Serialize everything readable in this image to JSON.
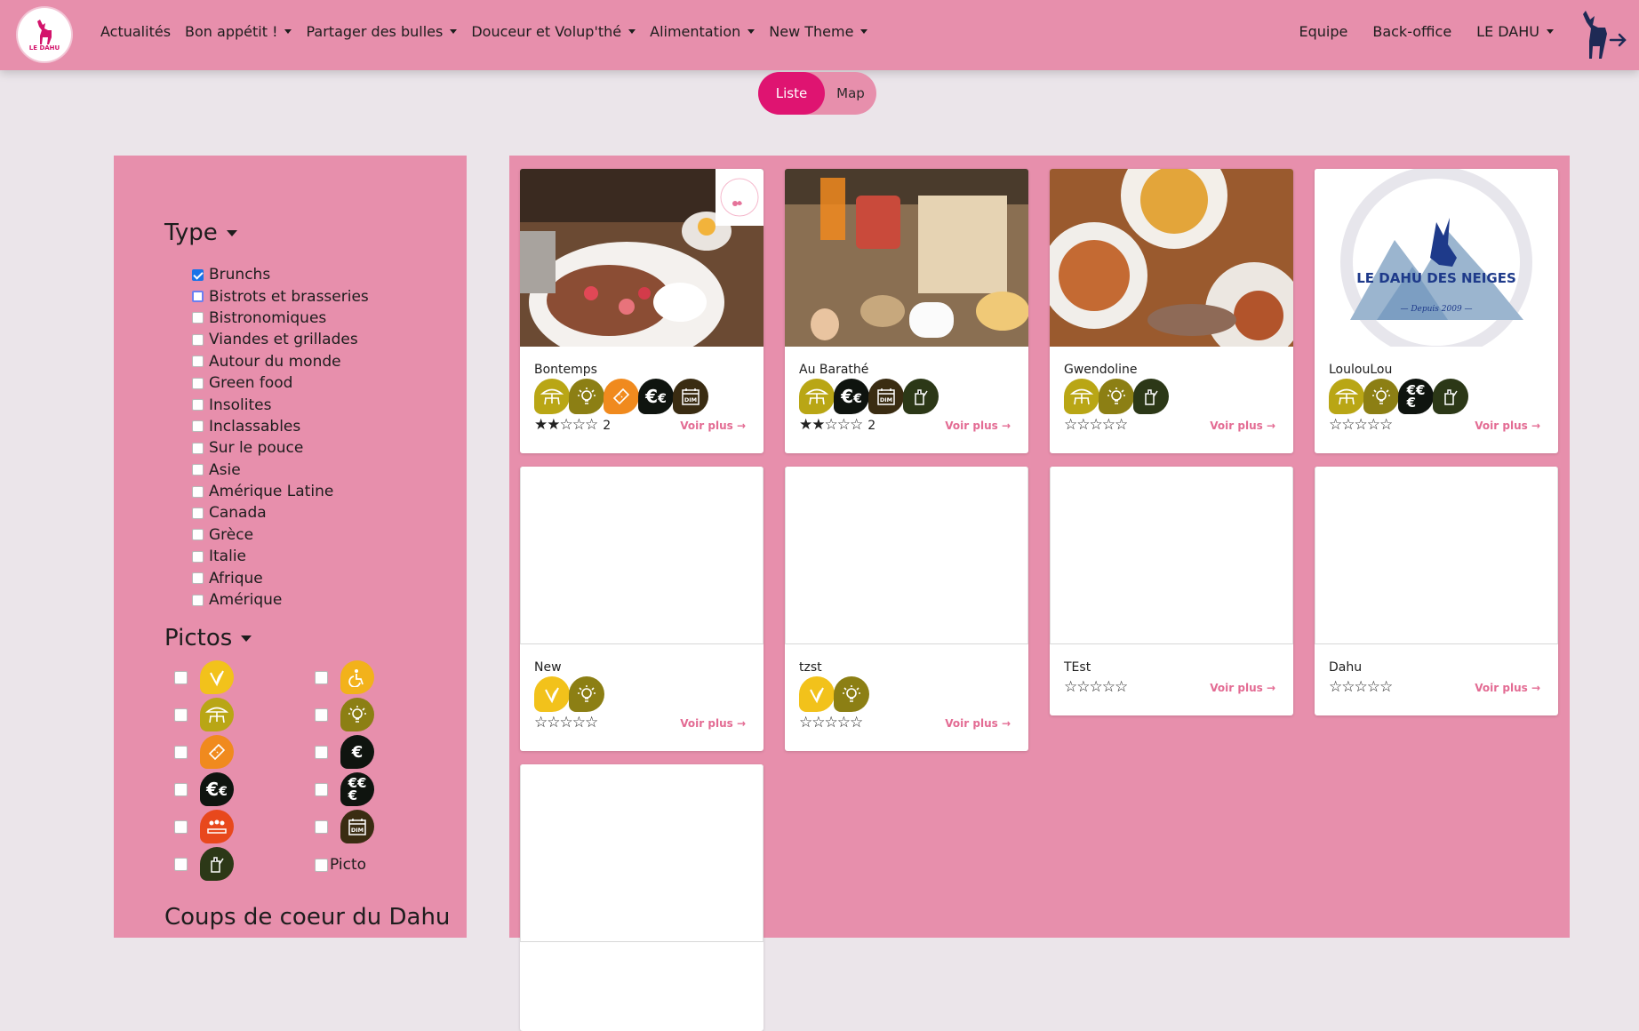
{
  "app": {
    "logo_text": "LE DAHU"
  },
  "nav": {
    "left": [
      {
        "label": "Actualités",
        "dropdown": false
      },
      {
        "label": "Bon appétit !",
        "dropdown": true
      },
      {
        "label": "Partager des bulles",
        "dropdown": true
      },
      {
        "label": "Douceur et Volup'thé",
        "dropdown": true
      },
      {
        "label": "Alimentation",
        "dropdown": true
      },
      {
        "label": "New Theme",
        "dropdown": true
      }
    ],
    "right": [
      {
        "label": "Equipe",
        "dropdown": false
      },
      {
        "label": "Back-office",
        "dropdown": false
      },
      {
        "label": "LE DAHU",
        "dropdown": true
      }
    ]
  },
  "view_toggle": {
    "liste": "Liste",
    "map": "Map",
    "active": "liste"
  },
  "filters": {
    "type_title": "Type",
    "types": [
      {
        "label": "Brunchs",
        "checked": true
      },
      {
        "label": "Bistrots et brasseries",
        "checked": false,
        "focused": true
      },
      {
        "label": "Bistronomiques",
        "checked": false
      },
      {
        "label": "Viandes et grillades",
        "checked": false
      },
      {
        "label": "Autour du monde",
        "checked": false
      },
      {
        "label": "Green food",
        "checked": false
      },
      {
        "label": "Insolites",
        "checked": false
      },
      {
        "label": "Inclassables",
        "checked": false
      },
      {
        "label": "Sur le pouce",
        "checked": false
      },
      {
        "label": "Asie",
        "checked": false
      },
      {
        "label": "Amérique Latine",
        "checked": false
      },
      {
        "label": "Canada",
        "checked": false
      },
      {
        "label": "Grèce",
        "checked": false
      },
      {
        "label": "Italie",
        "checked": false
      },
      {
        "label": "Afrique",
        "checked": false
      },
      {
        "label": "Amérique",
        "checked": false
      }
    ],
    "pictos_title": "Pictos",
    "pictos_left": [
      "vegetarian-icon",
      "terrace-icon",
      "ticket-icon",
      "euro-one-icon",
      "group-icon",
      "wine-bottle-icon"
    ],
    "pictos_right": [
      "accessible-icon",
      "idea-bulb-icon",
      "euro-cheap-icon",
      "euro-two-icon",
      "sunday-open-icon",
      "picto-text"
    ],
    "picto_text_label": "Picto",
    "coups_title": "Coups de coeur du Dahu"
  },
  "colors": {
    "brand_pink": "#e78fac",
    "accent": "#df1471",
    "page_bg": "#ebe5ea"
  },
  "cards": [
    {
      "name": "Bontemps",
      "image": "photo-brunch-bowl",
      "badge": "pink-stamp",
      "icons": [
        "terrace-icon",
        "idea-bulb-icon",
        "ticket-icon",
        "euro-one-icon",
        "sunday-open-icon"
      ],
      "rating": 2,
      "rating_count": "2",
      "link": "Voir plus"
    },
    {
      "name": "Au Barathé",
      "image": "photo-brunch-table",
      "icons": [
        "terrace-icon",
        "euro-one-icon",
        "sunday-open-icon",
        "wine-bottle-icon"
      ],
      "rating": 2,
      "rating_count": "2",
      "link": "Voir plus"
    },
    {
      "name": "Gwendoline",
      "image": "photo-plates",
      "icons": [
        "terrace-icon",
        "idea-bulb-icon",
        "wine-bottle-icon"
      ],
      "rating": 0,
      "rating_count": "",
      "link": "Voir plus"
    },
    {
      "name": "LoulouLou",
      "image": "logo-dahu-des-neiges",
      "logo_title": "LE DAHU DES NEIGES",
      "logo_sub": "Depuis 2009",
      "icons": [
        "terrace-icon",
        "idea-bulb-icon",
        "euro-two-icon",
        "wine-bottle-icon"
      ],
      "rating": 0,
      "rating_count": "",
      "link": "Voir plus"
    },
    {
      "name": "New",
      "image": "",
      "icons": [
        "vegetarian-icon",
        "idea-bulb-icon"
      ],
      "rating": 0,
      "rating_count": "",
      "link": "Voir plus"
    },
    {
      "name": "tzst",
      "image": "",
      "icons": [
        "vegetarian-icon",
        "idea-bulb-icon"
      ],
      "rating": 0,
      "rating_count": "",
      "link": "Voir plus"
    },
    {
      "name": "TEst",
      "image": "",
      "icons": [],
      "rating": 0,
      "rating_count": "",
      "link": "Voir plus"
    },
    {
      "name": "Dahu",
      "image": "",
      "icons": [],
      "rating": 0,
      "rating_count": "",
      "link": "Voir plus"
    },
    {
      "name": "",
      "image": "",
      "icons": [],
      "rating": 0,
      "rating_count": "",
      "link": ""
    }
  ]
}
